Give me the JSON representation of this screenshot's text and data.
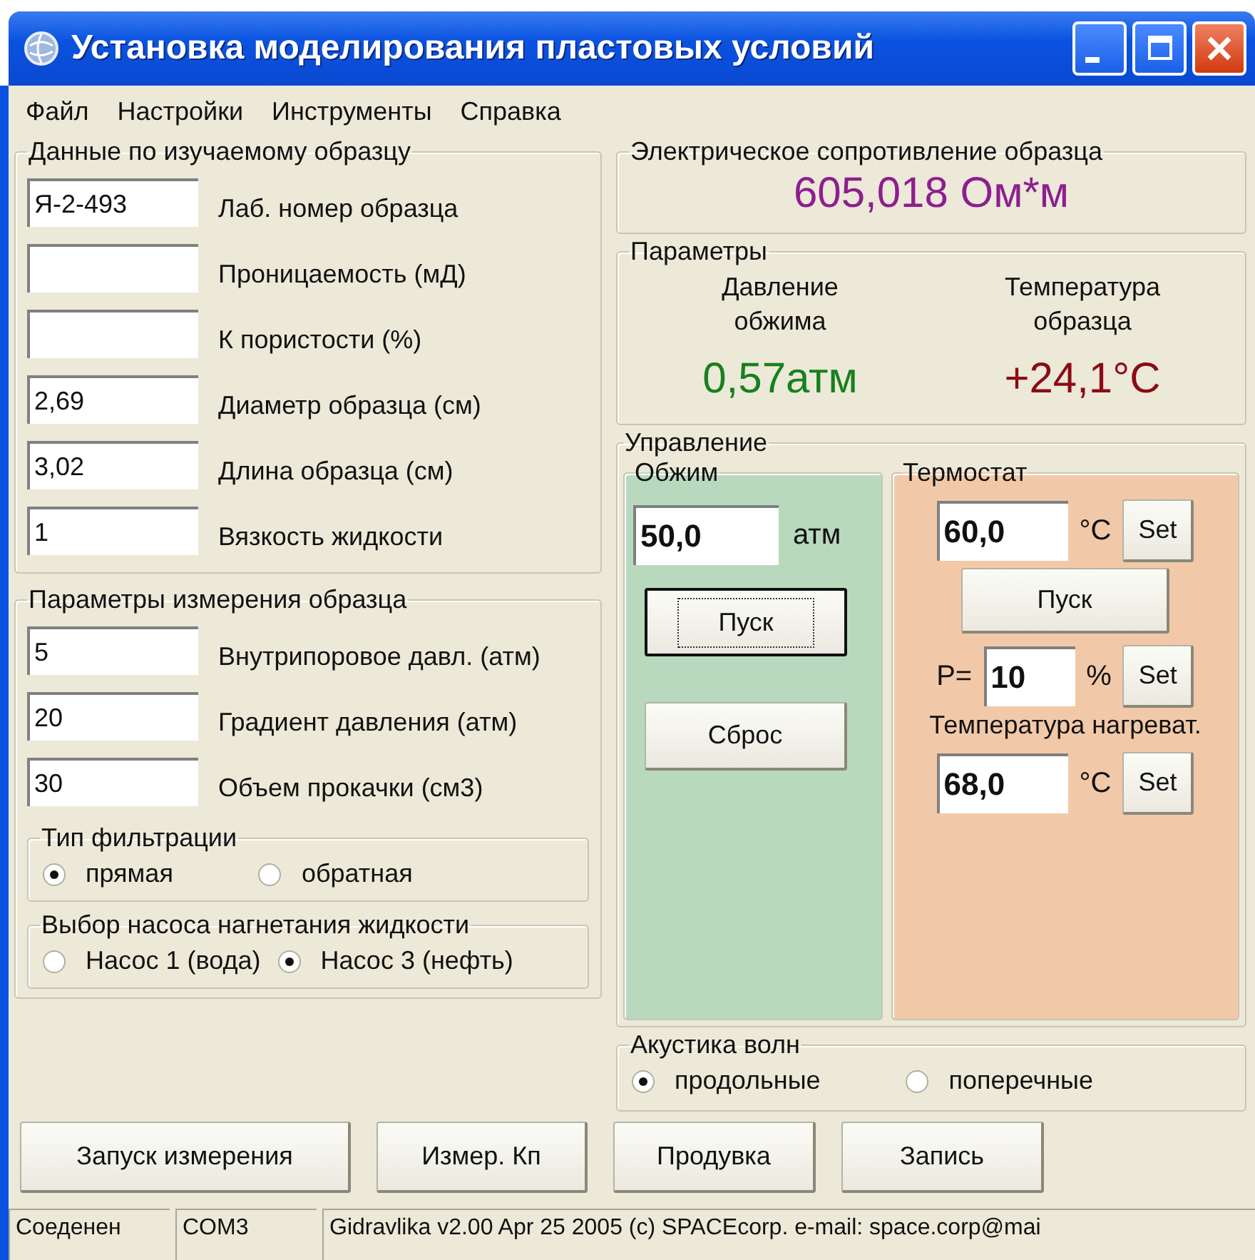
{
  "window": {
    "title": "Установка моделирования пластовых условий"
  },
  "menu": [
    "Файл",
    "Настройки",
    "Инструменты",
    "Справка"
  ],
  "sample_data": {
    "title": "Данные по изучаемому образцу",
    "fields": [
      {
        "value": "Я-2-493",
        "label": "Лаб. номер образца"
      },
      {
        "label": "Проницаемость (мД)"
      },
      {
        "label": "К пористости (%)"
      },
      {
        "value": "2,69",
        "label": "Диаметр образца (см)"
      },
      {
        "value": "3,02",
        "label": "Длина образца (см)"
      },
      {
        "value": "1",
        "label": "Вязкость жидкости"
      }
    ]
  },
  "measurement": {
    "title": "Параметры измерения образца",
    "fields": [
      {
        "value": "5",
        "label": "Внутрипоровое давл. (атм)"
      },
      {
        "value": "20",
        "label": "Градиент давления (атм)"
      },
      {
        "value": "30",
        "label": "Объем прокачки (см3)"
      }
    ],
    "filtration": {
      "title": "Тип фильтрации",
      "options": [
        {
          "label": "прямая",
          "selected": true
        },
        {
          "label": "обратная",
          "selected": false
        }
      ]
    },
    "pump": {
      "title": "Выбор насоса нагнетания жидкости",
      "options": [
        {
          "label": "Насос 1 (вода)",
          "selected": false
        },
        {
          "label": "Насос 3 (нефть)",
          "selected": true
        }
      ]
    }
  },
  "resistance": {
    "title": "Электрическое сопротивление образца",
    "value": "605,018 Ом*м"
  },
  "parameters": {
    "title": "Параметры",
    "items": [
      {
        "label": "Давление обжима",
        "value": "0,57атм",
        "color": "#17801e"
      },
      {
        "label": "Температура образца",
        "value": "+24,1°C",
        "color": "#8c0a14"
      }
    ]
  },
  "control": {
    "title": "Управление",
    "compression": {
      "title": "Обжим",
      "value": "50,0",
      "unit": "атм",
      "buttons": [
        {
          "label": "Пуск",
          "focused": true
        },
        {
          "label": "Сброс",
          "focused": false
        }
      ]
    },
    "thermostat": {
      "title": "Термостат",
      "setpoint": {
        "value": "60,0",
        "unit": "°C",
        "button": "Set"
      },
      "start_button": "Пуск",
      "power": {
        "prefix": "P=",
        "value": "10",
        "unit": "%",
        "button": "Set"
      },
      "heater_label": "Температура нагреват.",
      "heater": {
        "value": "68,0",
        "unit": "°C",
        "button": "Set"
      }
    }
  },
  "acoustics": {
    "title": "Акустика волн",
    "options": [
      {
        "label": "продольные",
        "selected": true
      },
      {
        "label": "поперечные",
        "selected": false
      }
    ]
  },
  "buttons": [
    "Запуск измерения",
    "Измер. Кп",
    "Продувка",
    "Запись"
  ],
  "status_bar": [
    "Соеденен",
    "COM3",
    "Gidravlika v2.00 Apr 25 2005 (c) SPACEcorp. e-mail: space.corp@mai"
  ]
}
